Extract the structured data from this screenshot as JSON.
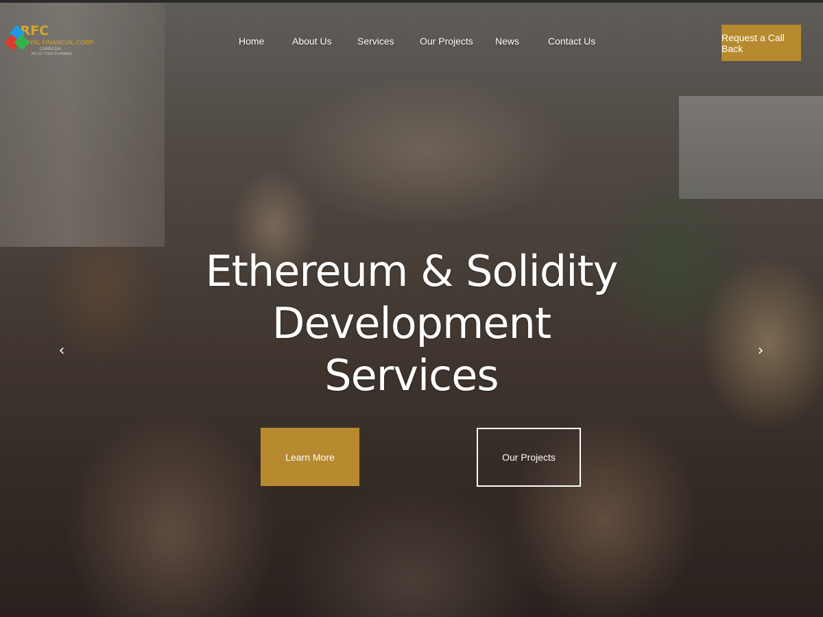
{
  "header": {
    "logo": {
      "abbr": "RFC",
      "name": "ROYAL FINANCIAL CORP.",
      "region": "CAMBODIA",
      "tagline": "WE DO YOUR PLANNING",
      "icon": "diamond-logo-icon",
      "colors": [
        "#1e9be0",
        "#e03a2e",
        "#34b24a",
        "#d6a829"
      ]
    },
    "nav": [
      {
        "label": "Home"
      },
      {
        "label": "About Us"
      },
      {
        "label": "Services"
      },
      {
        "label": "Our Projects"
      },
      {
        "label": "News"
      },
      {
        "label": "Contact Us"
      }
    ],
    "cta": "Request a Call Back"
  },
  "hero": {
    "title_line1": "Ethereum & Solidity Development",
    "title_line2": "Services",
    "primary_button": "Learn More",
    "secondary_button": "Our Projects",
    "prev_icon": "chevron-left-icon",
    "next_icon": "chevron-right-icon"
  },
  "colors": {
    "accent": "#b78a2f",
    "text": "#ffffff"
  }
}
